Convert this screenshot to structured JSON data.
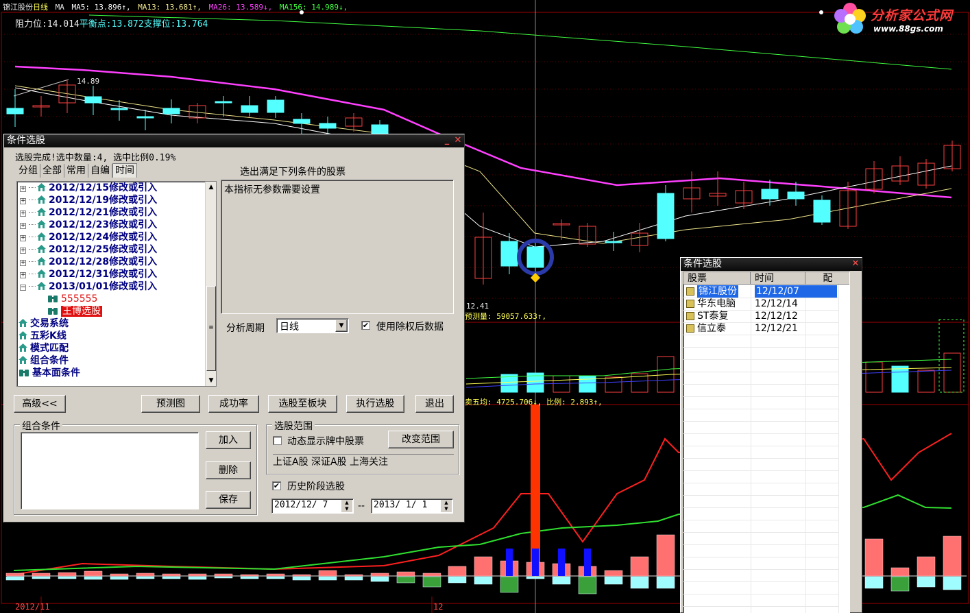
{
  "chart": {
    "stock_name": "锦江股份",
    "period": "日线",
    "ma_label": "MA",
    "ma_values": [
      {
        "text": "MA5: 13.896↑,",
        "color": "#ffffff"
      },
      {
        "text": "MA13: 13.681↑,",
        "color": "#f0e68c"
      },
      {
        "text": "MA26: 13.589↓,",
        "color": "#ff40ff"
      },
      {
        "text": "MA156: 14.989↓,",
        "color": "#40ff40"
      }
    ],
    "resistance": "阻力位:14.014",
    "balance": "平衡点:13.872",
    "support": "支撑位:13.764",
    "high_label": "14.89",
    "low_label": "12.41",
    "forecast_volume": "预测量: 59057.633↑,",
    "sell_avg": "卖五均: 4725.706↓, 比例: 2.893↑,",
    "date_left": "2012/11",
    "date_mid": "12",
    "colors": {
      "up": "#ff4040",
      "down": "#54ffff",
      "ma5": "#ffffff",
      "ma13": "#f0e68c",
      "ma26": "#ff40ff",
      "ma156": "#40ff40"
    }
  },
  "logo": {
    "name": "分析家公式网",
    "url": "www.88gs.com"
  },
  "dialog_main": {
    "title": "条件选股",
    "status": "选股完成!选中数量:4, 选中比例0.19%",
    "tabs": [
      "分组",
      "全部",
      "常用",
      "自编",
      "时间"
    ],
    "tree_items": [
      "2012/12/15修改或引入",
      "2012/12/19修改或引入",
      "2012/12/21修改或引入",
      "2012/12/23修改或引入",
      "2012/12/24修改或引入",
      "2012/12/25修改或引入",
      "2012/12/28修改或引入",
      "2012/12/31修改或引入",
      "2013/01/01修改或引入"
    ],
    "tree_children": [
      "555555",
      "王博选股"
    ],
    "tree_roots": [
      "交易系统",
      "五彩K线",
      "模式匹配",
      "组合条件",
      "基本面条件"
    ],
    "right_title": "选出满足下列条件的股票",
    "right_desc": "本指标无参数需要设置",
    "period_label": "分析周期",
    "period_value": "日线",
    "use_adjusted": "使用除权后数据",
    "buttons": {
      "advanced": "高级<<",
      "forecast": "预测图",
      "success_rate": "成功率",
      "to_sector": "选股至板块",
      "execute": "执行选股",
      "exit": "退出"
    },
    "combo_group": "组合条件",
    "combo_buttons": {
      "add": "加入",
      "delete": "删除",
      "save": "保存"
    },
    "range_group": "选股范围",
    "dynamic_display": "动态显示牌中股票",
    "change_range": "改变范围",
    "range_text": "上证A股 深证A股 上海关注",
    "history": "历史阶段选股",
    "date_from": "2012/12/ 7",
    "date_sep": "--",
    "date_to": "2013/ 1/ 1"
  },
  "dialog_results": {
    "title": "条件选股",
    "columns": [
      "股票",
      "时间",
      "配"
    ],
    "rows": [
      {
        "name": "锦江股份",
        "time": "12/12/07"
      },
      {
        "name": "华东电脑",
        "time": "12/12/14"
      },
      {
        "name": "ST泰复",
        "time": "12/12/12"
      },
      {
        "name": "信立泰",
        "time": "12/12/21"
      }
    ]
  }
}
